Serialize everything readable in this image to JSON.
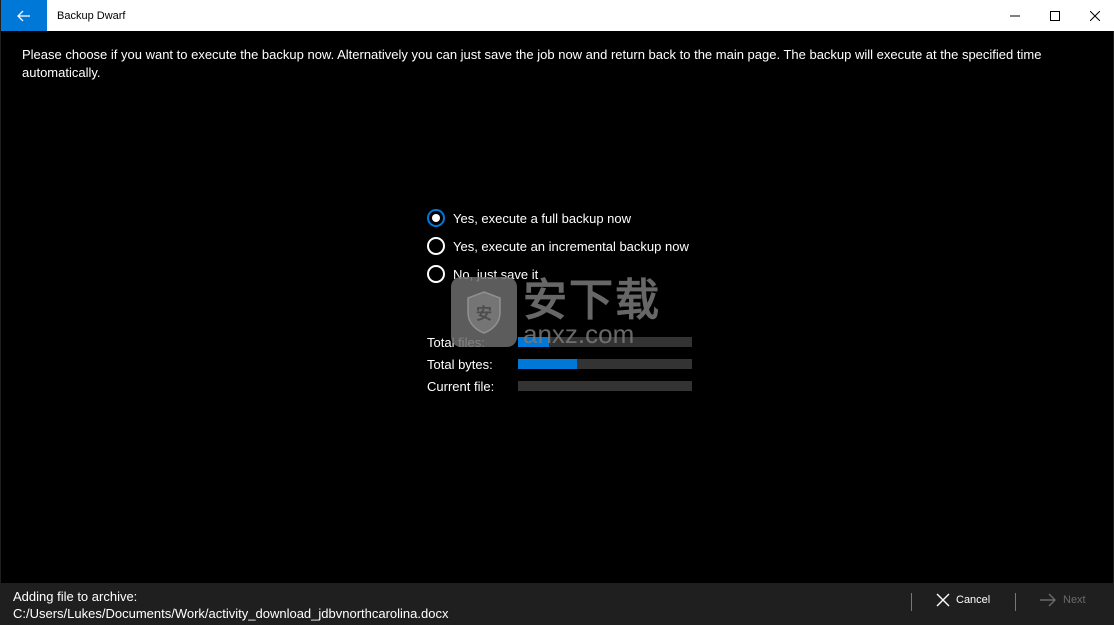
{
  "window": {
    "title": "Backup Dwarf"
  },
  "intro_text": "Please choose if you want to execute the backup now. Alternatively you can just save the job now and return back to the main page. The backup will execute at the specified time automatically.",
  "options": [
    {
      "label": "Yes, execute a full backup now",
      "selected": true
    },
    {
      "label": "Yes, execute an incremental backup now",
      "selected": false
    },
    {
      "label": "No, just save it",
      "selected": false
    }
  ],
  "progress": {
    "total_files_label": "Total files:",
    "total_files_fraction": 0.18,
    "total_bytes_label": "Total bytes:",
    "total_bytes_fraction": 0.34,
    "current_file_label": "Current file:",
    "current_file_fraction": 0.0
  },
  "watermark": {
    "cn": "安下载",
    "en": "anxz.com"
  },
  "status": {
    "line1": "Adding file to archive:",
    "line2": "C:/Users/Lukes/Documents/Work/activity_download_jdbvnorthcarolina.docx"
  },
  "buttons": {
    "cancel": "Cancel",
    "next": "Next"
  },
  "colors": {
    "accent": "#0078d7",
    "track": "#333333",
    "bottombar": "#1f1f1f"
  }
}
